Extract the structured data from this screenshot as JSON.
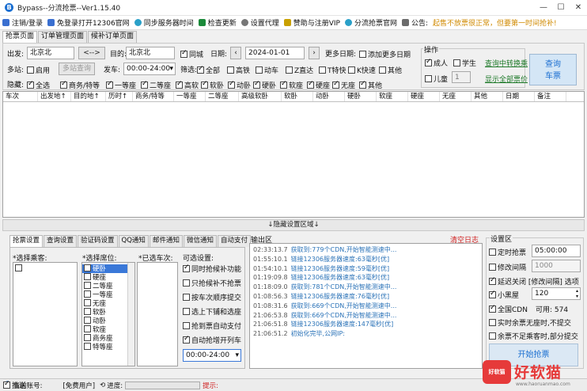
{
  "window": {
    "title": "Bypass--分流抢票--Ver1.15.40",
    "minimize": "—",
    "maximize": "☐",
    "close": "✕"
  },
  "menu": [
    {
      "label": "注销/登录",
      "icon": "monitor-icon",
      "color": "#3a6fd0"
    },
    {
      "label": "免登录打开12306官网",
      "icon": "page-icon",
      "color": "#3a6fd0"
    },
    {
      "label": "同步服务器时间",
      "icon": "clock-icon",
      "color": "#2aa0c8"
    },
    {
      "label": "检查更新",
      "icon": "refresh-icon",
      "color": "#1b8a3a"
    },
    {
      "label": "设置代理",
      "icon": "gear-icon",
      "color": "#777777"
    },
    {
      "label": "赞助与注册VIP",
      "icon": "sponsor-icon",
      "color": "#c9a000"
    },
    {
      "label": "分流抢票官网",
      "icon": "globe-icon",
      "color": "#2aa0c8"
    },
    {
      "label": "公告:",
      "icon": "speaker-icon",
      "color": "#6b6b6b"
    }
  ],
  "notice": "起售不放票很正常，但要第一时间抢补!",
  "top_tabs": [
    "抢票页面",
    "订单管理页面",
    "候补订单页面"
  ],
  "form": {
    "from_label": "出发:",
    "from_value": "北京北",
    "swap_label": "<-->",
    "to_label": "目的:",
    "to_value": "北京北",
    "same_city": "同城",
    "date_label": "日期:",
    "date_prev": "‹",
    "date_value": "2024-01-01",
    "date_next": "›",
    "more_dates_label": "更多日期:",
    "add_more_dates": "添加更多日期",
    "multi_station_label": "多站:",
    "enable": "启用",
    "multi_query_btn": "多站查询",
    "depart_label": "发车:",
    "depart_value": "00:00-24:00",
    "filter_label": "筛选:",
    "filters": [
      "全部",
      "高铁",
      "动车",
      "Z直达",
      "T特快",
      "K快速",
      "其他"
    ],
    "hide_label": "隐藏:",
    "hide_options": [
      "全选",
      "商务/特等",
      "一等座",
      "二等座",
      "高软",
      "软卧",
      "动卧",
      "硬卧",
      "软座",
      "硬座",
      "无座",
      "其他"
    ]
  },
  "ops": {
    "title": "操作",
    "adult": "成人",
    "student": "学生",
    "child": "儿童",
    "child_count": "1",
    "link_transfer": "查询中转换乘",
    "link_full_price": "显示全部票价",
    "query_btn_line1": "查询",
    "query_btn_line2": "车票"
  },
  "grid_columns": [
    "车次",
    "出发地↑",
    "目的地↑",
    "历时↑",
    "商务/特等",
    "一等座",
    "二等座",
    "高级软卧",
    "软卧",
    "动卧",
    "硬卧",
    "软座",
    "硬座",
    "无座",
    "其他",
    "日期",
    "备注"
  ],
  "hide_bar": "↓隐藏设置区域↓",
  "bottom_tabs": [
    "抢票设置",
    "查询设置",
    "验证码设置",
    "QQ通知",
    "邮件通知",
    "微信通知",
    "自动支付"
  ],
  "passenger_label": "*选择乘客:",
  "seat_label": "*选择席位:",
  "seats": [
    "硬卧",
    "硬座",
    "二等座",
    "一等座",
    "无座",
    "软卧",
    "动卧",
    "软座",
    "商务座",
    "特等座"
  ],
  "train_label": "*已选车次:",
  "options_label": "可选设置:",
  "options": [
    {
      "label": "同时抢候补功能",
      "checked": true
    },
    {
      "label": "只抢候补不抢票",
      "checked": false
    },
    {
      "label": "按车次顺序提交",
      "checked": false
    },
    {
      "label": "选上下铺和选座",
      "checked": false
    },
    {
      "label": "抢到票自动支付",
      "checked": false
    },
    {
      "label": "自动抢增开列车",
      "checked": true
    }
  ],
  "option_time": "00:00-24:00",
  "log": {
    "title": "输出区",
    "clear": "清空日志",
    "lines": [
      {
        "time": "02:33:13.7",
        "msg": "获取到:779个CDN,开始智能测速中..."
      },
      {
        "time": "01:55:10.1",
        "msg": "链接12306服务器速度:63毫秒[优]"
      },
      {
        "time": "01:54:10.1",
        "msg": "链接12306服务器速度:59毫秒[优]"
      },
      {
        "time": "01:19:09.8",
        "msg": "链接12306服务器速度:63毫秒[优]"
      },
      {
        "time": "01:18:09.0",
        "msg": "获取到:781个CDN,开始智能测速中..."
      },
      {
        "time": "01:08:56.3",
        "msg": "链接12306服务器速度:76毫秒[优]"
      },
      {
        "time": "01:08:31.6",
        "msg": "获取到:669个CDN,开始智能测速中..."
      },
      {
        "time": "21:06:53.8",
        "msg": "获取到:669个CDN,开始智能测速中..."
      },
      {
        "time": "21:06:51.8",
        "msg": "链接12306服务器速度:147毫秒[优]"
      },
      {
        "time": "21:06:51.2",
        "msg": "初始化完毕,公网IP:"
      }
    ]
  },
  "settings": {
    "title": "设置区",
    "timed": "定时抢票",
    "timed_value": "05:00:00",
    "interval": "修改间隔",
    "interval_value": "1000",
    "delay": "延迟关闭 [修改间隔] 选项",
    "blackroom": "小黑屋",
    "blackroom_value": "120",
    "cdn": "全国CDN",
    "cdn_available": "可用: 574",
    "realtime": "实时余票无座时,不提交",
    "insufficient": "余票不足乘客时,部分提交",
    "start_btn": "开始抢票"
  },
  "status": {
    "account_label": "当前账号:",
    "user_type": "[免费用户]",
    "push": "推送",
    "progress_label": "进度:",
    "progress_pct": 0,
    "tail": "提示:"
  },
  "watermark": {
    "badge": "好软猫",
    "text": "好软猫",
    "url": "www.haoruanmao.com"
  }
}
